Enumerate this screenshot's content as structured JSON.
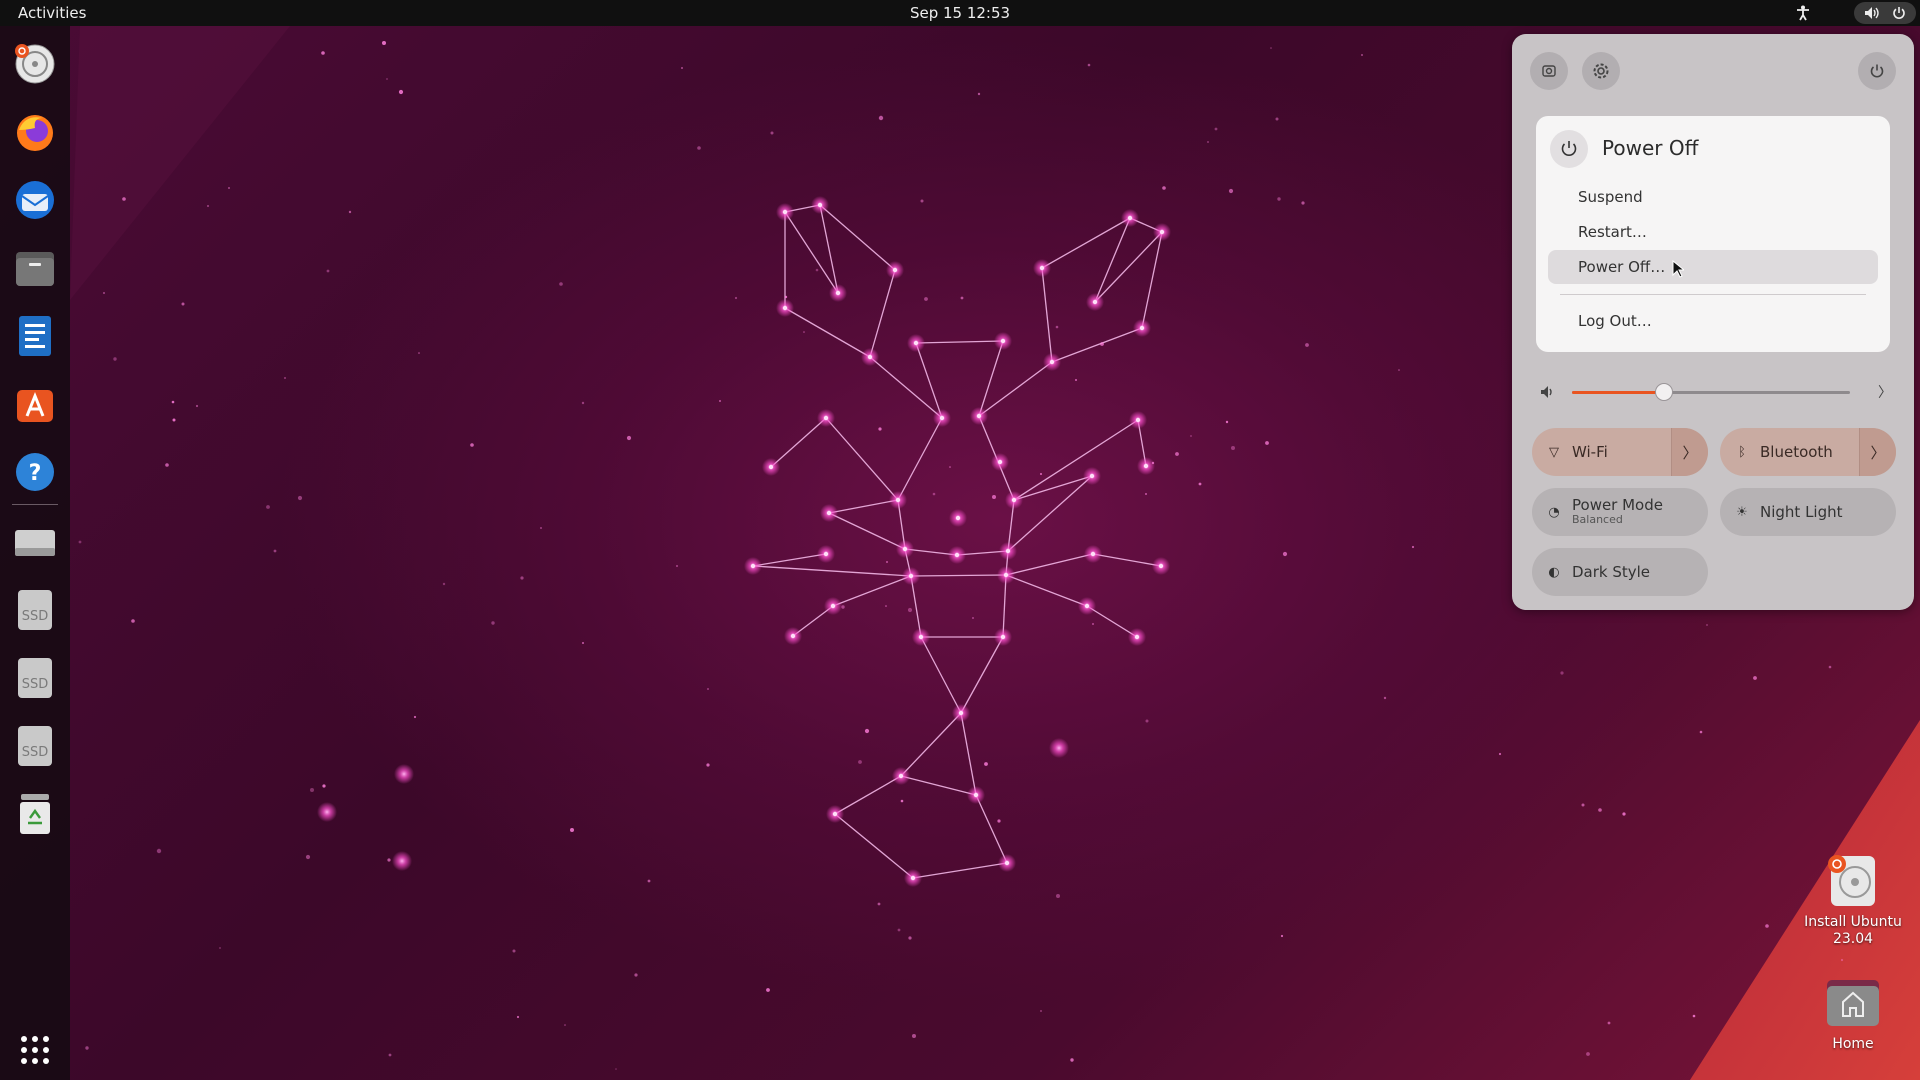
{
  "topbar": {
    "activities": "Activities",
    "clock": "Sep 15  12:53",
    "icons": [
      "accessibility-icon",
      "volume-icon",
      "power-icon"
    ]
  },
  "dock": {
    "apps": [
      {
        "name": "Install Ubuntu",
        "icon": "installer-icon"
      },
      {
        "name": "Firefox",
        "icon": "firefox-icon"
      },
      {
        "name": "Thunderbird",
        "icon": "thunderbird-icon"
      },
      {
        "name": "Files",
        "icon": "files-icon"
      },
      {
        "name": "LibreOffice Writer",
        "icon": "writer-icon"
      },
      {
        "name": "App Center",
        "icon": "appcenter-icon"
      },
      {
        "name": "Help",
        "icon": "help-icon"
      }
    ],
    "drives": [
      {
        "label": ""
      },
      {
        "label": "SSD"
      },
      {
        "label": "SSD"
      },
      {
        "label": "SSD"
      }
    ],
    "trash": "trash-icon",
    "show_apps": "grid-icon"
  },
  "quick_settings": {
    "power_menu": {
      "title": "Power Off",
      "items": [
        "Suspend",
        "Restart…",
        "Power Off…",
        "Log Out…"
      ],
      "active_item": "Power Off…"
    },
    "volume": {
      "level": 0.33
    },
    "toggles": [
      {
        "label": "Wi-Fi",
        "sub": "",
        "state": "on",
        "has_arrow": true,
        "icon": "wifi-icon"
      },
      {
        "label": "Bluetooth",
        "sub": "",
        "state": "on",
        "has_arrow": true,
        "icon": "bluetooth-icon"
      },
      {
        "label": "Power Mode",
        "sub": "Balanced",
        "state": "off",
        "has_arrow": false,
        "icon": "power-mode-icon"
      },
      {
        "label": "Night Light",
        "sub": "",
        "state": "off",
        "has_arrow": false,
        "icon": "night-light-icon"
      },
      {
        "label": "Dark Style",
        "sub": "",
        "state": "off",
        "has_arrow": false,
        "icon": "dark-style-icon"
      }
    ]
  },
  "desktop": {
    "icons": [
      {
        "label": "Install Ubuntu\n23.04",
        "icon": "installer-icon"
      },
      {
        "label": "Home",
        "icon": "home-folder-icon"
      }
    ]
  },
  "colors": {
    "accent": "#e95420",
    "panel_bg": "#c8c4c6",
    "topbar_bg": "#101010"
  }
}
